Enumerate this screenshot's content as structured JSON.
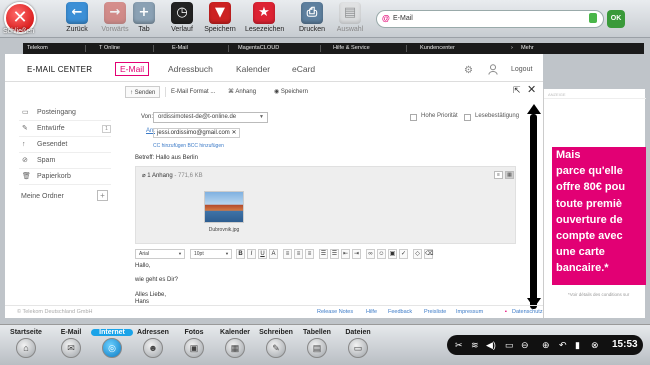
{
  "toolbar": {
    "close_label": "Schließen",
    "buttons": [
      {
        "label": "Zurück",
        "icon": "back-arrow-icon"
      },
      {
        "label": "Vorwärts",
        "icon": "forward-arrow-icon"
      },
      {
        "label": "Tab",
        "icon": "new-tab-icon"
      },
      {
        "label": "Verlauf",
        "icon": "history-icon"
      },
      {
        "label": "Speichern",
        "icon": "save-icon"
      },
      {
        "label": "Lesezeichen",
        "icon": "bookmarks-icon"
      },
      {
        "label": "Drucken",
        "icon": "print-icon"
      },
      {
        "label": "Auswahl",
        "icon": "selection-icon"
      }
    ],
    "url": "E-Mail",
    "ok_label": "OK"
  },
  "dark_nav": {
    "items": [
      "Telekom",
      "T Online",
      "E-Mail",
      "MagentaCLOUD",
      "Hilfe & Service",
      "Kundencenter",
      "Mehr"
    ]
  },
  "header": {
    "brand": "E-MAIL CENTER",
    "tabs": [
      "E-Mail",
      "Adressbuch",
      "Kalender",
      "eCard"
    ],
    "logout": "Logout"
  },
  "sidebar": {
    "items": [
      {
        "label": "Posteingang"
      },
      {
        "label": "Entwürfe",
        "count": "1"
      },
      {
        "label": "Gesendet"
      },
      {
        "label": "Spam"
      },
      {
        "label": "Papierkorb"
      }
    ],
    "folders_label": "Meine Ordner"
  },
  "compose": {
    "send": "Senden",
    "format": "E-Mail Format ...",
    "attach": "Anhang",
    "save": "Speichern",
    "from_label": "Von:",
    "from_value": "ordissimotest-de@t-online.de",
    "priority_label": "Hohe Priorität",
    "receipt_label": "Lesebestätigung",
    "to_label": "An:",
    "to_value": "jessi.ordissimo@gmail.com",
    "cc_bcc": "CC hinzufügen  BCC hinzufügen",
    "subject_label": "Betreff:",
    "subject_value": "Hallo aus Berlin",
    "attachment_title": "1 Anhang",
    "attachment_size": "- 771,6 KB",
    "attachment_filename": "Dubrovnik.jpg",
    "font": "Arial",
    "size": "10pt",
    "body_lines": [
      "Hallo,",
      "wie geht es Dir?",
      "Alles Liebe,",
      "Hans"
    ]
  },
  "footer": {
    "copyright": "© Telekom Deutschland GmbH",
    "links": [
      "Release Notes",
      "Hilfe",
      "Feedback",
      "Preisliste",
      "Impressum",
      "Datenschutz"
    ]
  },
  "ad": {
    "tag": "ANZEIGE",
    "lines": [
      "Mais",
      "parce qu'elle",
      "offre 80€ pou",
      "toute premiè",
      "ouverture de",
      "compte avec",
      "une carte",
      "bancaire.*"
    ],
    "fine_print": "*Voir détails des conditions sur",
    "brand_color": "#e20074"
  },
  "taskbar": {
    "items": [
      {
        "label": "Startseite",
        "icon": "home-icon"
      },
      {
        "label": "E-Mail",
        "icon": "mail-icon"
      },
      {
        "label": "Internet",
        "icon": "globe-icon"
      },
      {
        "label": "Adressen",
        "icon": "contacts-icon"
      },
      {
        "label": "Fotos",
        "icon": "photos-icon"
      },
      {
        "label": "Kalender",
        "icon": "calendar-icon"
      },
      {
        "label": "Schreiben",
        "icon": "write-icon"
      },
      {
        "label": "Tabellen",
        "icon": "spreadsheet-icon"
      },
      {
        "label": "Dateien",
        "icon": "files-icon"
      }
    ],
    "active": "Internet",
    "clock": "15:53"
  }
}
